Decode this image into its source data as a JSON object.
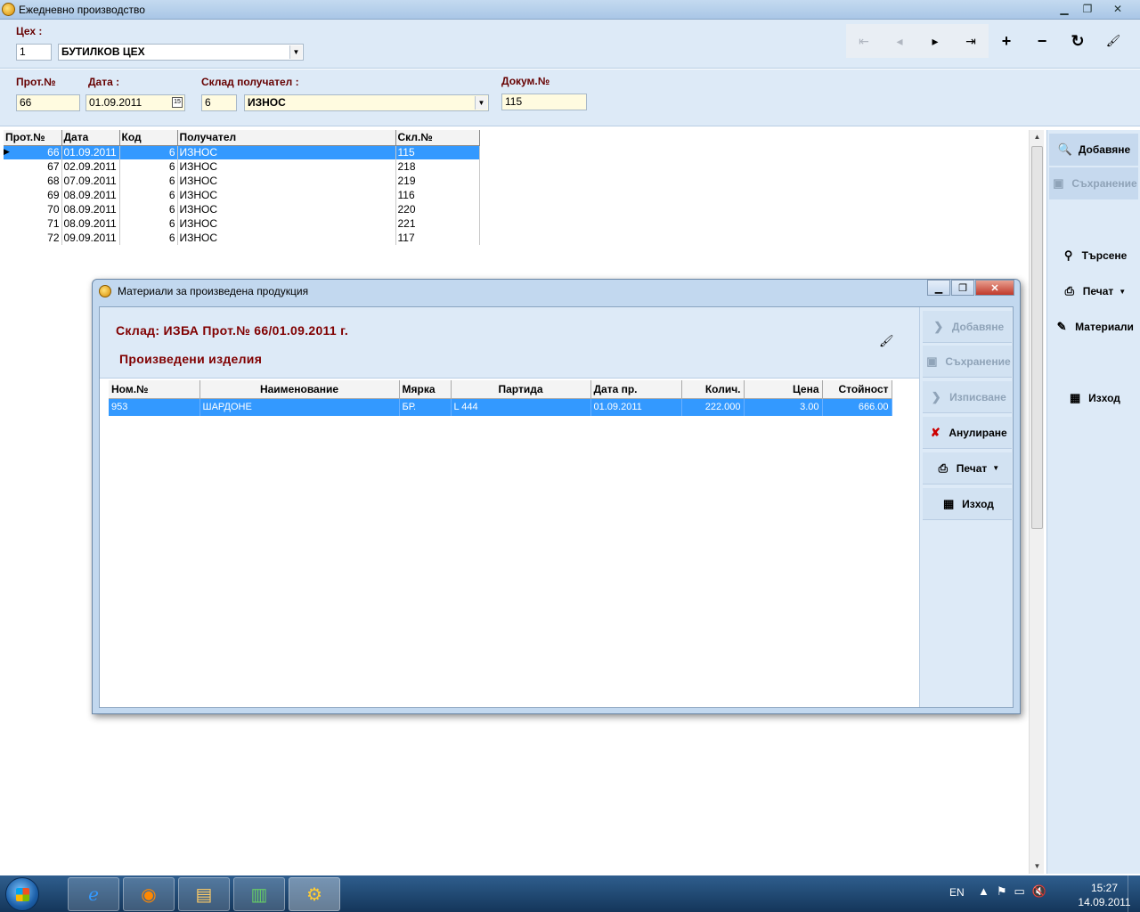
{
  "window": {
    "title": "Ежедневно производство"
  },
  "top": {
    "cex_label": "Цех :",
    "cex_code": "1",
    "cex_name": "БУТИЛКОВ ЦЕХ"
  },
  "nav": {
    "first": "⇤",
    "prev": "◂",
    "next": "▸",
    "last": "⇥",
    "add": "+",
    "remove": "−",
    "refresh": "↻",
    "clear": "🖌"
  },
  "header": {
    "prot_label": "Прот.№",
    "prot_value": "66",
    "date_label": "Дата :",
    "date_value": "01.09.2011",
    "warehouse_label": "Склад получател :",
    "warehouse_code": "6",
    "warehouse_name": "ИЗНОС",
    "doc_label": "Докум.№",
    "doc_value": "115"
  },
  "grid": {
    "columns": [
      "Прот.№",
      "Дата",
      "Код",
      "Получател",
      "Скл.№"
    ],
    "rows": [
      [
        "66",
        "01.09.2011",
        "6",
        "ИЗНОС",
        "115"
      ],
      [
        "67",
        "02.09.2011",
        "6",
        "ИЗНОС",
        "218"
      ],
      [
        "68",
        "07.09.2011",
        "6",
        "ИЗНОС",
        "219"
      ],
      [
        "69",
        "08.09.2011",
        "6",
        "ИЗНОС",
        "116"
      ],
      [
        "70",
        "08.09.2011",
        "6",
        "ИЗНОС",
        "220"
      ],
      [
        "71",
        "08.09.2011",
        "6",
        "ИЗНОС",
        "221"
      ],
      [
        "72",
        "09.09.2011",
        "6",
        "ИЗНОС",
        "117"
      ]
    ]
  },
  "side": {
    "add": "Добавяне",
    "save": "Съхранение",
    "search": "Търсене",
    "print": "Печат",
    "materials": "Материали",
    "exit": "Изход"
  },
  "dialog": {
    "title": "Материали за произведена продукция",
    "heading": "Склад: ИЗБА Прот.№ 66/01.09.2011 г.",
    "subheading": "Произведени изделия",
    "columns": [
      "Ном.№",
      "Наименование",
      "Мярка",
      "Партида",
      "Дата пр.",
      "Колич.",
      "Цена",
      "Стойност"
    ],
    "rows": [
      [
        "953",
        "ШАРДОНЕ",
        "БР.",
        "L 444",
        "01.09.2011",
        "222.000",
        "3.00",
        "666.00"
      ]
    ],
    "buttons": {
      "add": "Добавяне",
      "save": "Съхранение",
      "write_off": "Изписване",
      "cancel": "Анулиране",
      "print": "Печат",
      "exit": "Изход"
    }
  },
  "taskbar": {
    "lang": "EN",
    "time": "15:27",
    "date": "14.09.2011"
  },
  "colors": {
    "selection": "#3399ff",
    "label": "#660000",
    "panel": "#ddeaf7"
  }
}
